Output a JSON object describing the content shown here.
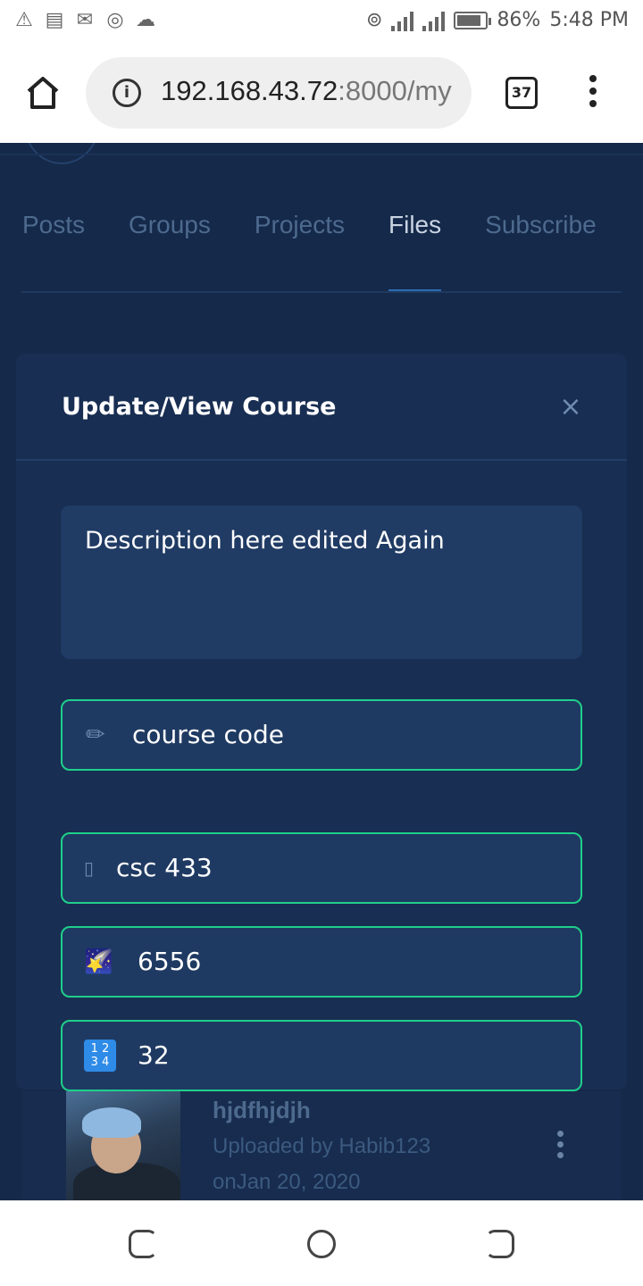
{
  "status_bar": {
    "battery": "86%",
    "time": "5:48 PM",
    "left_icons": [
      "warning-icon",
      "news-icon",
      "gmail-icon",
      "record-icon",
      "cloud-upload-icon"
    ],
    "right_icons": [
      "hotspot-icon",
      "signal-icon",
      "signal-icon",
      "battery-icon"
    ],
    "battery_level": 0.86
  },
  "browser": {
    "url_host": "192.168.43.72",
    "url_rest": ":8000/my",
    "tab_count": "37"
  },
  "nav_tabs": [
    {
      "label": "Posts",
      "active": false
    },
    {
      "label": "Groups",
      "active": false
    },
    {
      "label": "Projects",
      "active": false
    },
    {
      "label": "Files",
      "active": true
    },
    {
      "label": "Subscribe",
      "active": false
    }
  ],
  "modal": {
    "title": "Update/View Course",
    "close_glyph": "×",
    "description": "Description here edited Again",
    "fields": [
      {
        "icon": "pencil-icon",
        "glyph": "✏",
        "value": "course code"
      },
      {
        "icon": "missing-glyph-icon",
        "glyph": "▯",
        "value": "csc 433"
      },
      {
        "icon": "shooting-star-icon",
        "glyph": "🌠",
        "value": "6556"
      },
      {
        "icon": "numbers-icon",
        "glyph": "1 2 3 4",
        "value": "32"
      }
    ]
  },
  "file_item": {
    "title": "hjdfhjdjh",
    "uploaded_by": "Uploaded by Habib123",
    "date": "onJan 20, 2020"
  },
  "colors": {
    "page_bg": "#15294a",
    "modal_bg": "#182e52",
    "field_border": "#1fcf8a",
    "active_tab_underline": "#2d6bb4"
  }
}
